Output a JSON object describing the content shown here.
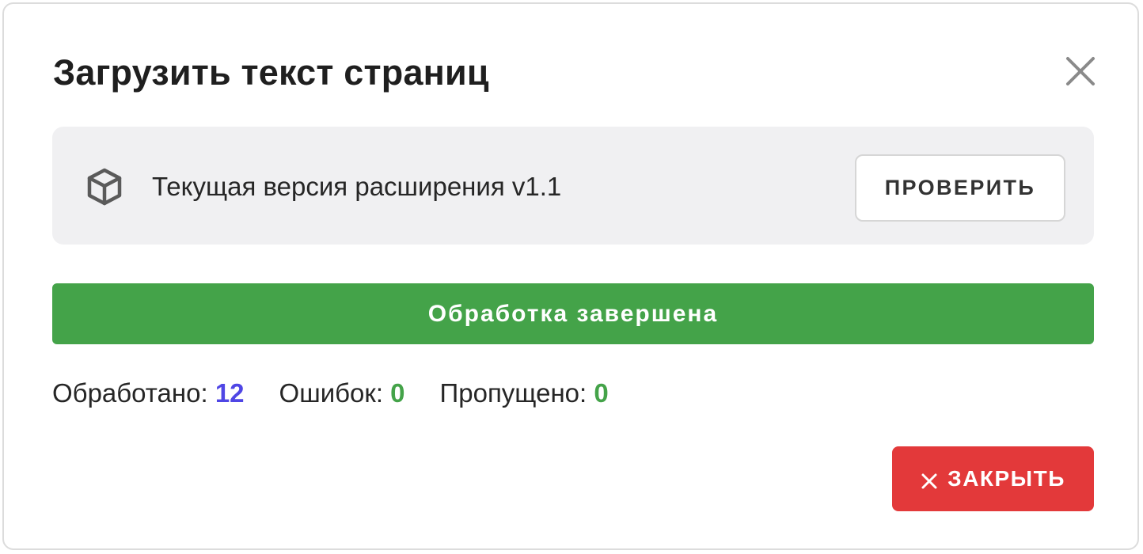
{
  "dialog": {
    "title": "Загрузить текст страниц",
    "close_icon": "close-icon"
  },
  "extension": {
    "icon": "package-cube-icon",
    "version_text": "Текущая версия расширения v1.1",
    "check_button_label": "ПРОВЕРИТЬ"
  },
  "status": {
    "message": "Обработка завершена",
    "color": "#44a349"
  },
  "stats": {
    "processed_label": "Обработано:",
    "processed_value": "12",
    "errors_label": "Ошибок:",
    "errors_value": "0",
    "skipped_label": "Пропущено:",
    "skipped_value": "0"
  },
  "footer": {
    "close_button_label": "ЗАКРЫТЬ",
    "close_button_icon": "close-icon",
    "close_button_color": "#e3393a"
  },
  "colors": {
    "accent_blue": "#4f46e5",
    "success_green": "#44a349",
    "danger_red": "#e3393a"
  }
}
